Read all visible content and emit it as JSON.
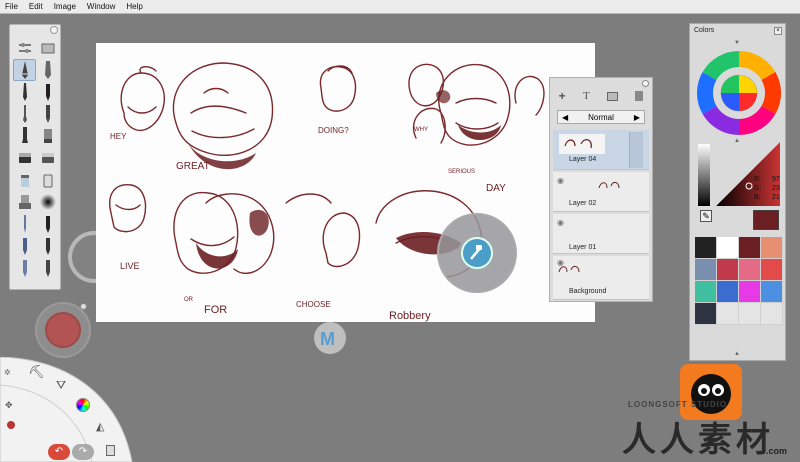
{
  "menu": [
    "File",
    "Edit",
    "Image",
    "Window",
    "Help"
  ],
  "canvas_text": {
    "hey": "HEY",
    "great": "GREAT",
    "doing": "DOING?",
    "why": "WHY",
    "serious": "SERIOUS",
    "day": "DAY",
    "live": "LIVE",
    "for": "FOR",
    "choose": "CHOOSE",
    "robbery": "Robbery",
    "or": "OR"
  },
  "layers": {
    "blend_mode": "Normal",
    "items": [
      {
        "label": "Layer 04"
      },
      {
        "label": "Layer 02"
      },
      {
        "label": "Layer 01"
      },
      {
        "label": "Background"
      }
    ]
  },
  "colors": {
    "title": "Colors",
    "readout": {
      "r_label": "R:",
      "r": "97",
      "g_label": "G:",
      "g": "23",
      "b_label": "B:",
      "b": "21"
    },
    "current": "#6b1f22",
    "swatches": [
      "#222222",
      "#ffffff",
      "#6b1f22",
      "#e68f72",
      "#7a8fb0",
      "#c03a4b",
      "#e56a85",
      "#e34a4a",
      "#3fbf9f",
      "#3b6ccf",
      "#e63ae6",
      "#4d8fe0",
      "#2d3340",
      "#e4e4e4",
      "#e4e4e4",
      "#e4e4e4"
    ]
  },
  "logo": {
    "watermark_cjk": "人人素材",
    "site": ".com",
    "studio": "LOONGSOFT STUDIO"
  }
}
